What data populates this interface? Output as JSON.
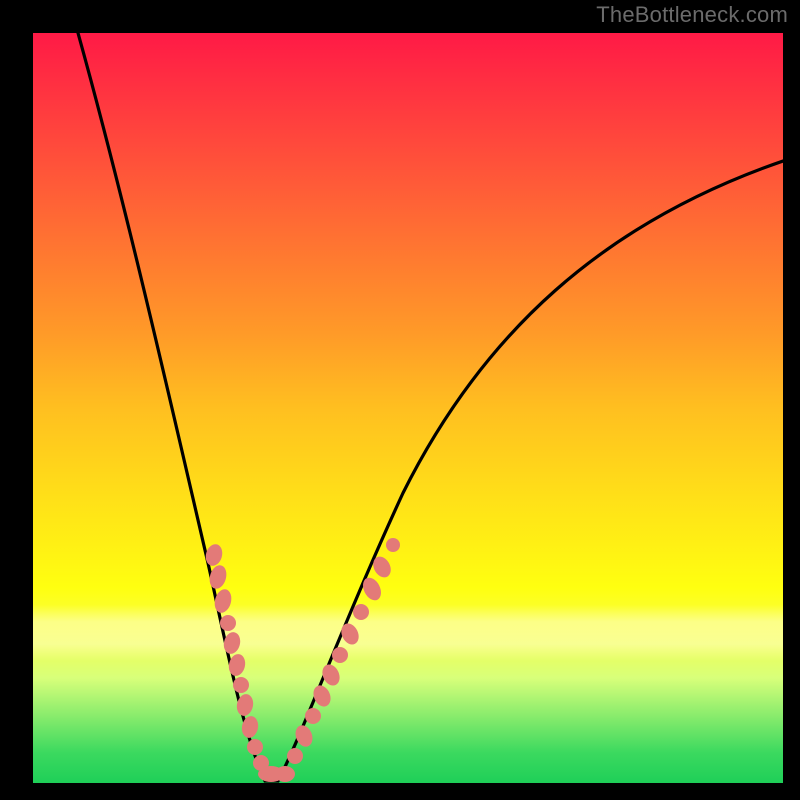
{
  "watermark": {
    "text": "TheBottleneck.com"
  },
  "colors": {
    "frame": "#000000",
    "curve": "#000000",
    "dots": "#e37a78",
    "gradient_top": "#ff1a46",
    "gradient_bottom": "#1fcf58"
  },
  "chart_data": {
    "type": "line",
    "title": "",
    "xlabel": "",
    "ylabel": "",
    "xlim": [
      0,
      100
    ],
    "ylim": [
      0,
      100
    ],
    "grid": false,
    "legend": false,
    "series": [
      {
        "name": "bottleneck-curve",
        "x": [
          6,
          10,
          14,
          18,
          20,
          22,
          24,
          26,
          27,
          28,
          29,
          30,
          31,
          32,
          34,
          36,
          38,
          40,
          44,
          48,
          54,
          60,
          68,
          78,
          88,
          100
        ],
        "y": [
          100,
          85,
          70,
          55,
          46,
          37,
          28,
          19,
          13,
          7,
          3,
          1,
          0,
          0.5,
          2,
          6,
          12,
          19,
          30,
          40,
          51,
          59,
          67,
          74,
          79,
          84
        ]
      }
    ],
    "points": [
      {
        "name": "left-cluster",
        "x": 24,
        "y": 30
      },
      {
        "name": "left-cluster",
        "x": 24.5,
        "y": 27
      },
      {
        "name": "left-cluster",
        "x": 25,
        "y": 24
      },
      {
        "name": "left-cluster",
        "x": 25.5,
        "y": 21
      },
      {
        "name": "left-cluster",
        "x": 26,
        "y": 18
      },
      {
        "name": "left-cluster",
        "x": 26.5,
        "y": 15
      },
      {
        "name": "left-cluster",
        "x": 27,
        "y": 12
      },
      {
        "name": "left-cluster",
        "x": 27.5,
        "y": 9
      },
      {
        "name": "left-cluster",
        "x": 28,
        "y": 6
      },
      {
        "name": "left-cluster",
        "x": 28.7,
        "y": 3.5
      },
      {
        "name": "bottom",
        "x": 29.5,
        "y": 1.5
      },
      {
        "name": "bottom",
        "x": 30.5,
        "y": 0.5
      },
      {
        "name": "bottom",
        "x": 31.5,
        "y": 0.3
      },
      {
        "name": "bottom",
        "x": 32.5,
        "y": 0.5
      },
      {
        "name": "bottom",
        "x": 33.5,
        "y": 1.5
      },
      {
        "name": "right-cluster",
        "x": 35,
        "y": 4
      },
      {
        "name": "right-cluster",
        "x": 36,
        "y": 7
      },
      {
        "name": "right-cluster",
        "x": 37,
        "y": 10
      },
      {
        "name": "right-cluster",
        "x": 38,
        "y": 13
      },
      {
        "name": "right-cluster",
        "x": 39,
        "y": 16
      },
      {
        "name": "right-cluster",
        "x": 40,
        "y": 19
      },
      {
        "name": "right-cluster",
        "x": 41,
        "y": 22
      },
      {
        "name": "right-cluster",
        "x": 42,
        "y": 25
      },
      {
        "name": "right-cluster",
        "x": 43.5,
        "y": 29
      },
      {
        "name": "right-cluster",
        "x": 45,
        "y": 32
      }
    ]
  }
}
